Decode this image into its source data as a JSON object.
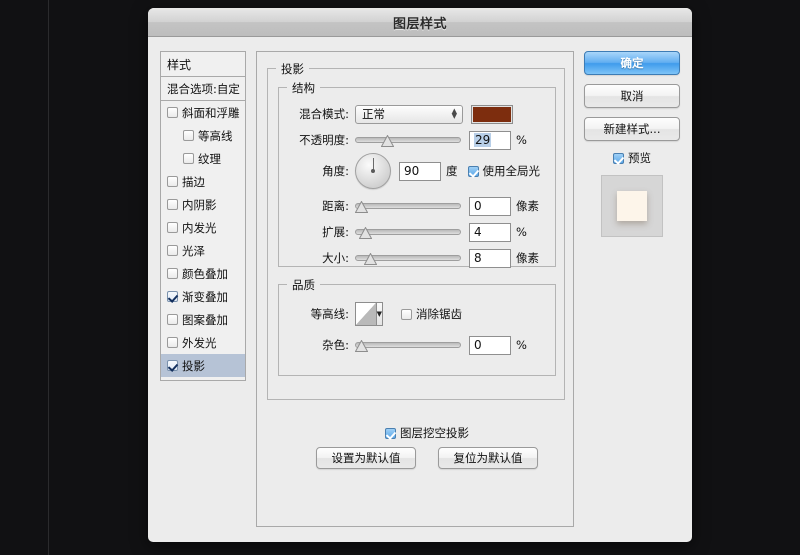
{
  "window": {
    "title": "图层样式"
  },
  "styles_panel": {
    "header": "样式",
    "blending_options": "混合选项:自定",
    "items": [
      {
        "label": "斜面和浮雕",
        "checked": false,
        "indent": false
      },
      {
        "label": "等高线",
        "checked": false,
        "indent": true
      },
      {
        "label": "纹理",
        "checked": false,
        "indent": true
      },
      {
        "label": "描边",
        "checked": false,
        "indent": false
      },
      {
        "label": "内阴影",
        "checked": false,
        "indent": false
      },
      {
        "label": "内发光",
        "checked": false,
        "indent": false
      },
      {
        "label": "光泽",
        "checked": false,
        "indent": false
      },
      {
        "label": "颜色叠加",
        "checked": false,
        "indent": false
      },
      {
        "label": "渐变叠加",
        "checked": true,
        "indent": false
      },
      {
        "label": "图案叠加",
        "checked": false,
        "indent": false
      },
      {
        "label": "外发光",
        "checked": false,
        "indent": false
      },
      {
        "label": "投影",
        "checked": true,
        "indent": false,
        "selected": true
      }
    ]
  },
  "main": {
    "section_title": "投影",
    "structure": {
      "legend": "结构",
      "blend_mode_label": "混合模式:",
      "blend_mode_value": "正常",
      "color_swatch": "#7d2d0e",
      "opacity_label": "不透明度:",
      "opacity_value": "29",
      "opacity_unit": "%",
      "angle_label": "角度:",
      "angle_value": "90",
      "angle_unit": "度",
      "global_light_label": "使用全局光",
      "global_light_checked": true,
      "distance_label": "距离:",
      "distance_value": "0",
      "distance_unit": "像素",
      "spread_label": "扩展:",
      "spread_value": "4",
      "spread_unit": "%",
      "size_label": "大小:",
      "size_value": "8",
      "size_unit": "像素"
    },
    "quality": {
      "legend": "品质",
      "contour_label": "等高线:",
      "antialias_label": "消除锯齿",
      "antialias_checked": false,
      "noise_label": "杂色:",
      "noise_value": "0",
      "noise_unit": "%"
    },
    "knockout_label": "图层挖空投影",
    "knockout_checked": true,
    "set_default_button": "设置为默认值",
    "reset_default_button": "复位为默认值"
  },
  "actions": {
    "ok": "确定",
    "cancel": "取消",
    "new_style": "新建样式...",
    "preview_label": "预览",
    "preview_checked": true
  }
}
